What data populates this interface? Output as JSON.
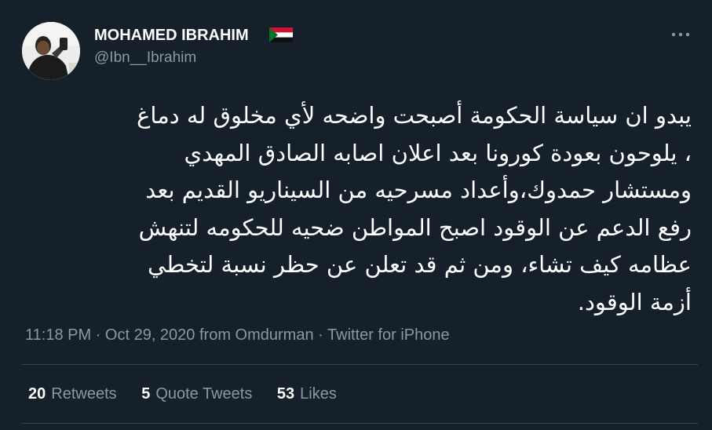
{
  "author": {
    "display_name": "MOHAMED IBRAHIM",
    "flag_icon": "sudan-flag-icon",
    "handle": "@Ibn__Ibrahim"
  },
  "tweet": {
    "lines": [
      "يبدو ان سياسة الحكومة أصبحت واضحه لأي مخلوق له دماغ",
      "، يلوحون بعودة كورونا بعد اعلان اصابه الصادق المهدي",
      "ومستشار حمدوك،وأعداد مسرحيه من السيناريو القديم بعد",
      "رفع الدعم عن الوقود اصبح المواطن ضحيه للحكومه لتنهش",
      "عظامه كيف تشاء، ومن ثم قد تعلن عن حظر نسبة لتخطي",
      "أزمة الوقود."
    ]
  },
  "meta": {
    "time": "11:18 PM",
    "sep1": " · ",
    "date": "Oct 29, 2020",
    "location": " from Omdurman",
    "sep2": " · ",
    "source": "Twitter for iPhone"
  },
  "stats": {
    "retweets": {
      "count": "20",
      "label": "Retweets"
    },
    "quotes": {
      "count": "5",
      "label": "Quote Tweets"
    },
    "likes": {
      "count": "53",
      "label": "Likes"
    }
  },
  "colors": {
    "background": "#15202b",
    "primary_text": "#ffffff",
    "secondary_text": "#8899a6",
    "divider": "#38444d"
  },
  "icons": {
    "more": "more-horizontal-icon"
  }
}
